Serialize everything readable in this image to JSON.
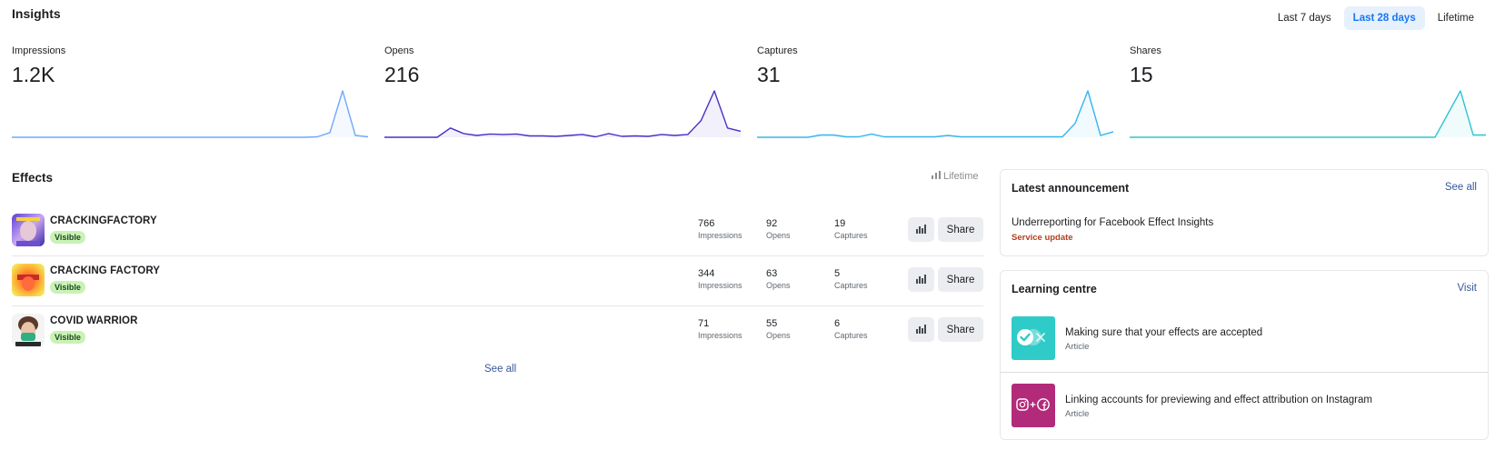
{
  "header": {
    "title": "Insights",
    "ranges": [
      {
        "label": "Last 7 days",
        "active": false
      },
      {
        "label": "Last 28 days",
        "active": true
      },
      {
        "label": "Lifetime",
        "active": false
      }
    ]
  },
  "metrics": [
    {
      "label": "Impressions",
      "value": "1.2K",
      "color": "#6ea8fe",
      "trend": [
        0,
        0,
        0,
        0,
        0,
        0,
        0,
        0,
        0,
        0,
        0,
        0,
        0,
        0,
        0,
        0,
        0,
        0,
        0,
        0,
        0,
        0,
        0,
        0,
        1,
        10,
        100,
        4,
        1
      ]
    },
    {
      "label": "Opens",
      "value": "216",
      "color": "#4a2fc9",
      "trend": [
        0,
        0,
        0,
        0,
        0,
        20,
        8,
        4,
        7,
        6,
        7,
        3,
        3,
        2,
        4,
        6,
        1,
        8,
        2,
        3,
        2,
        6,
        4,
        6,
        36,
        100,
        20,
        13
      ]
    },
    {
      "label": "Captures",
      "value": "31",
      "color": "#35b5ea",
      "trend": [
        0,
        0,
        0,
        0,
        0,
        5,
        5,
        1,
        1,
        7,
        1,
        1,
        1,
        1,
        1,
        4,
        1,
        1,
        1,
        1,
        1,
        1,
        1,
        1,
        1,
        30,
        100,
        4,
        12
      ]
    },
    {
      "label": "Shares",
      "value": "15",
      "color": "#2fc4d4",
      "trend": [
        0,
        0,
        0,
        0,
        0,
        0,
        0,
        0,
        0,
        0,
        0,
        0,
        0,
        0,
        0,
        0,
        0,
        0,
        0,
        0,
        0,
        0,
        0,
        0,
        0,
        50,
        100,
        5,
        5
      ]
    }
  ],
  "effects": {
    "title": "Effects",
    "period": "Lifetime",
    "stat_labels": {
      "impressions": "Impressions",
      "opens": "Opens",
      "captures": "Captures"
    },
    "share_label": "Share",
    "see_all": "See all",
    "items": [
      {
        "name": "CRACKINGFACTORY",
        "status": "Visible",
        "impressions": "766",
        "opens": "92",
        "captures": "19"
      },
      {
        "name": "CRACKING FACTORY",
        "status": "Visible",
        "impressions": "344",
        "opens": "63",
        "captures": "5"
      },
      {
        "name": "COVID WARRIOR",
        "status": "Visible",
        "impressions": "71",
        "opens": "55",
        "captures": "6"
      }
    ]
  },
  "announcement": {
    "title": "Latest announcement",
    "link": "See all",
    "headline": "Underreporting for Facebook Effect Insights",
    "tag": "Service update"
  },
  "learning": {
    "title": "Learning centre",
    "link": "Visit",
    "items": [
      {
        "title": "Making sure that your effects are accepted",
        "type": "Article",
        "color": "#2ecbc8"
      },
      {
        "title": "Linking accounts for previewing and effect attribution on Instagram",
        "type": "Article",
        "color": "#b22a7a"
      }
    ]
  }
}
